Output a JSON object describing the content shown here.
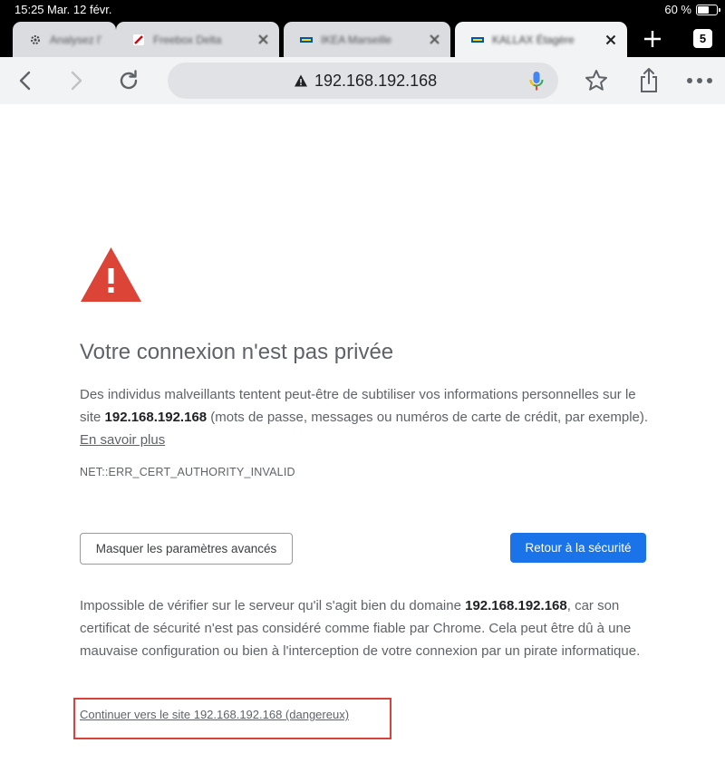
{
  "status_bar": {
    "time": "15:25",
    "date": "Mar. 12 févr.",
    "battery_text": "60 %",
    "battery_level": 0.6
  },
  "tabs": [
    {
      "title": "Analysez l'",
      "favicon": "gear-favicon-icon",
      "active": false
    },
    {
      "title": "Freebox Delta",
      "favicon": "freebox-favicon-icon",
      "active": false
    },
    {
      "title": "IKEA Marseille",
      "favicon": "ikea-favicon-icon",
      "active": false
    },
    {
      "title": "KALLAX Étagère",
      "favicon": "ikea-favicon-icon",
      "active": true
    }
  ],
  "tab_count": "5",
  "omnibox": {
    "url": "192.168.192.168",
    "security_icon": "warning-triangle-icon"
  },
  "page": {
    "headline": "Votre connexion n'est pas privée",
    "intro_part1": "Des individus malveillants tentent peut-être de subtiliser vos informations personnelles sur le site ",
    "intro_host": "192.168.192.168",
    "intro_part2": " (mots de passe, messages ou numéros de carte de crédit, par exemple). ",
    "learn_more": "En savoir plus",
    "error_code": "NET::ERR_CERT_AUTHORITY_INVALID",
    "advanced_button": "Masquer les paramètres avancés",
    "back_button": "Retour à la sécurité",
    "details_part1": "Impossible de vérifier sur le serveur qu'il s'agit bien du domaine ",
    "details_host": "192.168.192.168",
    "details_part2": ", car son certificat de sécurité n'est pas considéré comme fiable par Chrome. Cela peut être dû à une mauvaise configuration ou bien à l'interception de votre connexion par un pirate informatique.",
    "proceed_link": "Continuer vers le site 192.168.192.168 (dangereux)"
  },
  "colors": {
    "warning_red": "#db4437",
    "primary_blue": "#1a73e8",
    "highlight_box": "#d9423a"
  }
}
